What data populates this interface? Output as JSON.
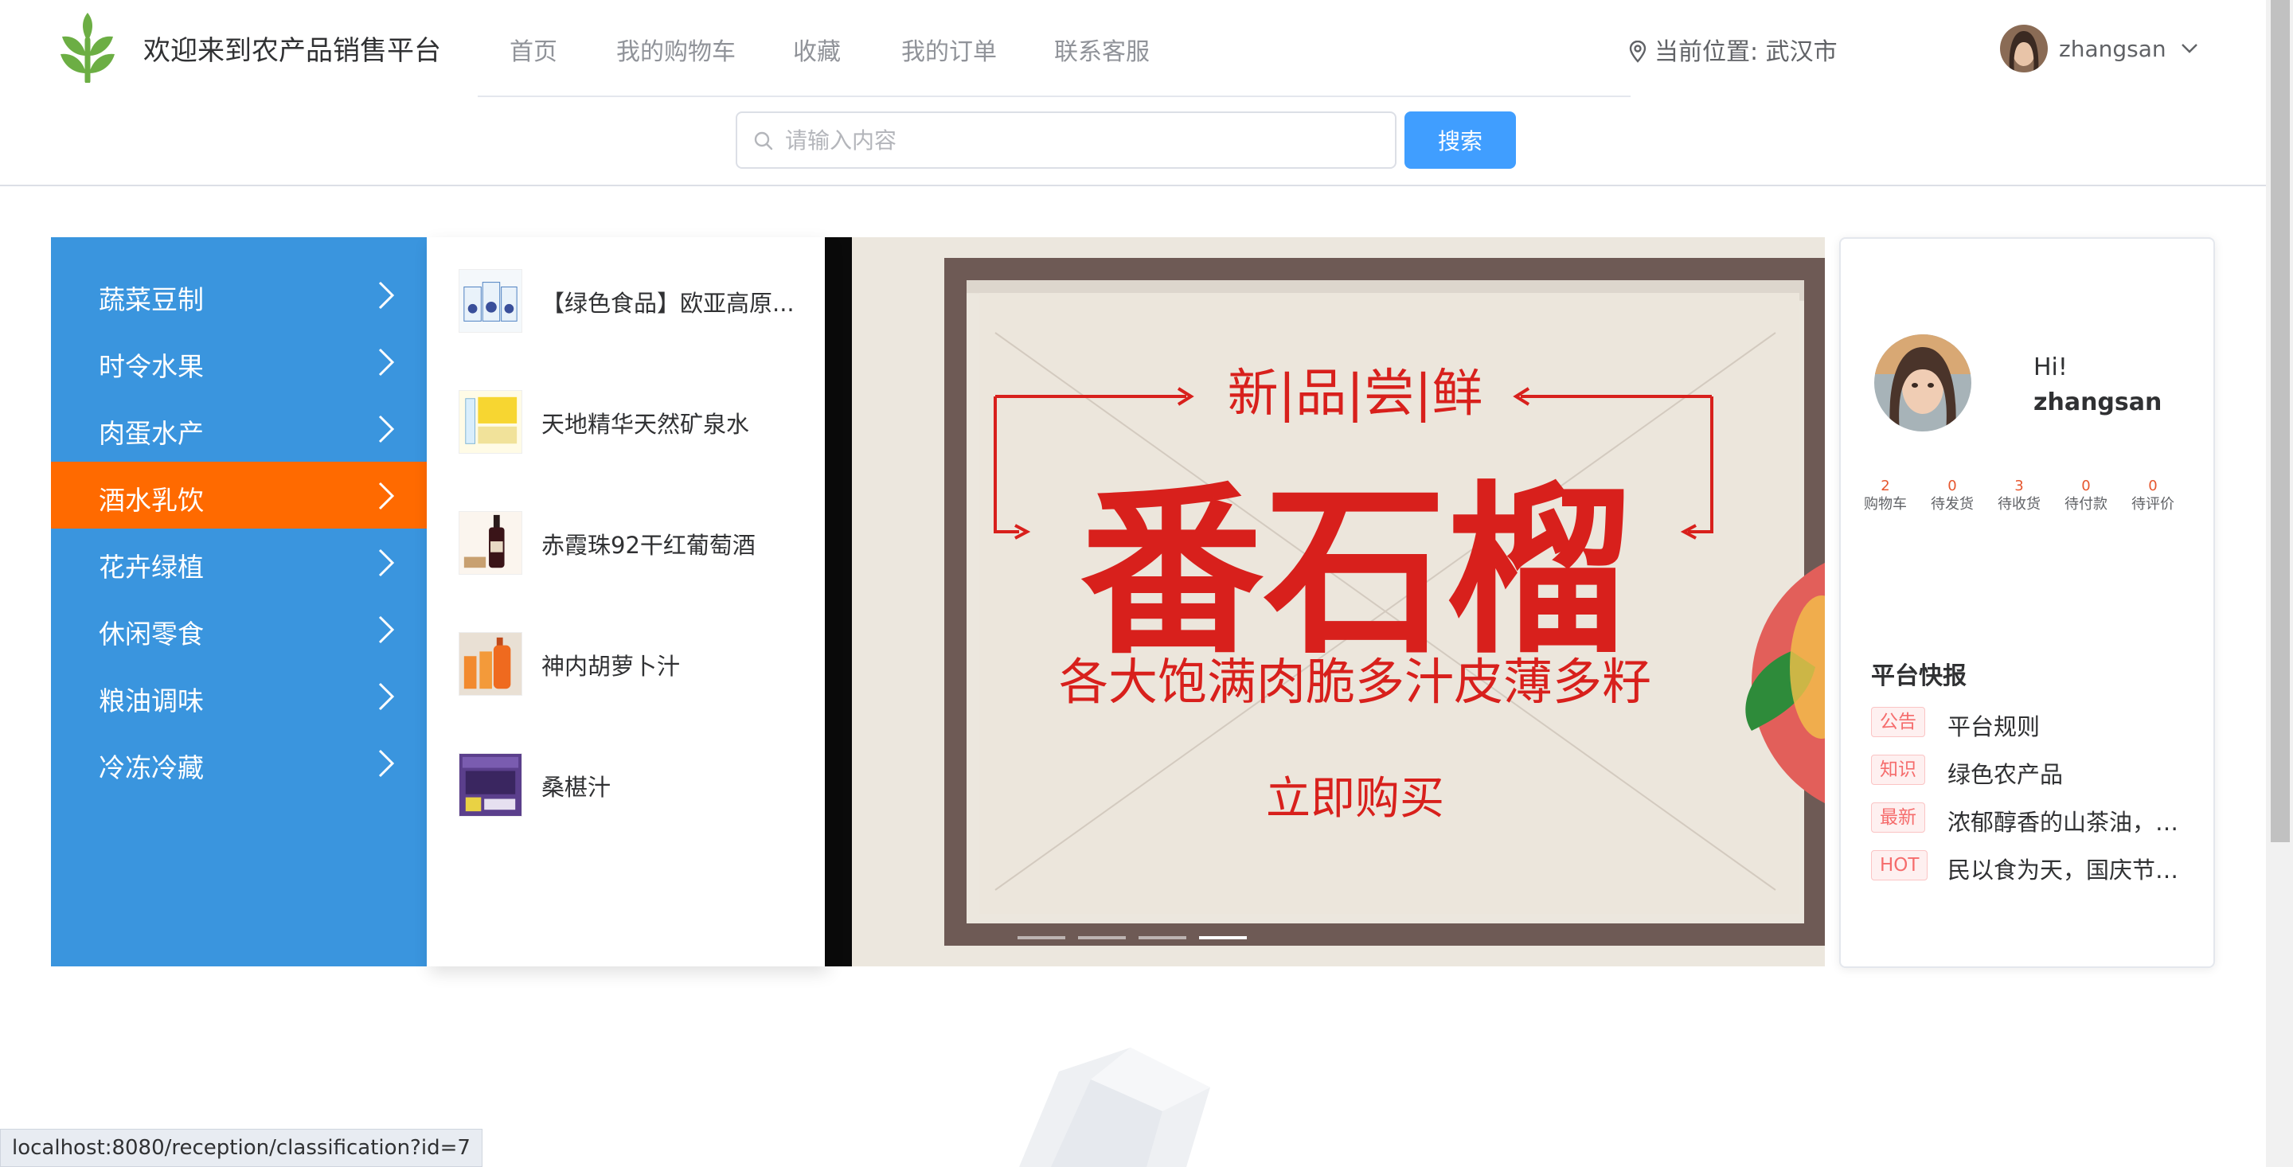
{
  "header": {
    "site_title": "欢迎来到农产品销售平台",
    "nav": [
      "首页",
      "我的购物车",
      "收藏",
      "我的订单",
      "联系客服"
    ],
    "location": "当前位置: 武汉市",
    "username": "zhangsan"
  },
  "search": {
    "placeholder": "请输入内容",
    "value": "",
    "button": "搜索"
  },
  "categories": [
    {
      "label": "蔬菜豆制"
    },
    {
      "label": "时令水果"
    },
    {
      "label": "肉蛋水产"
    },
    {
      "label": "酒水乳饮",
      "active": true
    },
    {
      "label": "花卉绿植"
    },
    {
      "label": "休闲零食"
    },
    {
      "label": "粮油调味"
    },
    {
      "label": "冷冻冷藏"
    }
  ],
  "popout_products": [
    {
      "name": "【绿色食品】欧亚高原..."
    },
    {
      "name": "天地精华天然矿泉水"
    },
    {
      "name": "赤霞珠92干红葡萄酒"
    },
    {
      "name": "神内胡萝卜汁"
    },
    {
      "name": "桑椹汁"
    }
  ],
  "banner": {
    "top_text": "新|品|尝|鲜",
    "main_text": "番石榴",
    "sub_text": "各大饱满肉脆多汁皮薄多籽",
    "cta_text": "立即购买",
    "slide_count": 4,
    "active_slide": 4
  },
  "user_card": {
    "greeting": "Hi!",
    "username": "zhangsan",
    "stats": [
      {
        "num": "2",
        "label": "购物车"
      },
      {
        "num": "0",
        "label": "待发货"
      },
      {
        "num": "3",
        "label": "待收货"
      },
      {
        "num": "0",
        "label": "待付款"
      },
      {
        "num": "0",
        "label": "待评价"
      }
    ],
    "news_title": "平台快报",
    "news": [
      {
        "tag": "公告",
        "text": "平台规则"
      },
      {
        "tag": "知识",
        "text": "绿色农产品"
      },
      {
        "tag": "最新",
        "text": "浓郁醇香的山茶油，帮..."
      },
      {
        "tag": "HOT",
        "text": "民以食为天，国庆节送..."
      }
    ]
  },
  "status_url": "localhost:8080/reception/classification?id=7",
  "colors": {
    "primary": "#409eff",
    "category_bg": "#3a95de",
    "active_category": "#ff6a00",
    "banner_red": "#d8201c",
    "logo_green": "#6cae44"
  }
}
